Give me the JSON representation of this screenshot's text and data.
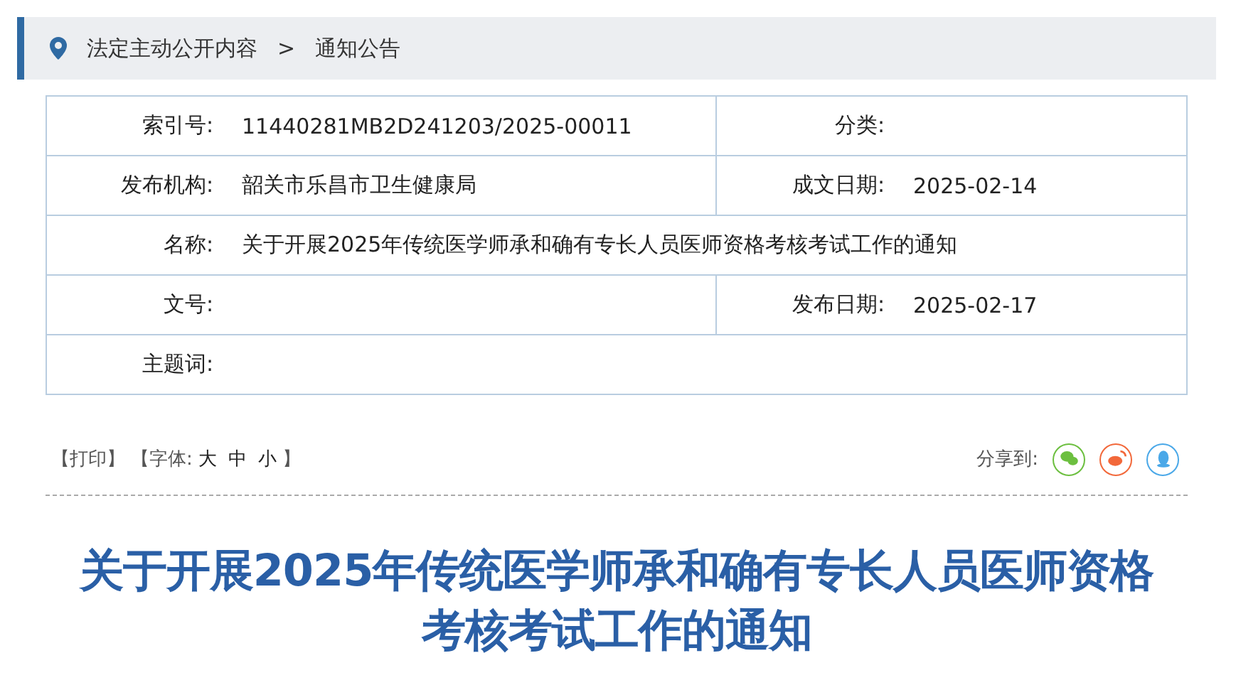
{
  "breadcrumb": {
    "items": [
      {
        "label": "法定主动公开内容"
      },
      {
        "label": "通知公告"
      }
    ],
    "separator": ">"
  },
  "info_table": {
    "rows": [
      {
        "kind": "split",
        "cells": [
          {
            "label": "索引号:",
            "value": "11440281MB2D241203/2025-00011"
          },
          {
            "label": "分类:"
          }
        ]
      },
      {
        "kind": "split",
        "cells": [
          {
            "label": "发布机构:",
            "value": "韶关市乐昌市卫生健康局"
          },
          {
            "label": "成文日期:",
            "value": "2025-02-14"
          }
        ]
      },
      {
        "kind": "full",
        "cells": [
          {
            "label": "名称:",
            "value": "关于开展2025年传统医学师承和确有专长人员医师资格考核考试工作的通知"
          }
        ]
      },
      {
        "kind": "split",
        "cells": [
          {
            "label": "文号:"
          },
          {
            "label": "发布日期:",
            "value": "2025-02-17"
          }
        ]
      },
      {
        "kind": "full",
        "cells": [
          {
            "label": "主题词:"
          }
        ]
      }
    ]
  },
  "toolbar": {
    "print": "【打印】",
    "font_label": "【字体:",
    "font_sizes": [
      "大",
      "中",
      "小"
    ],
    "font_close": "】",
    "share_label": "分享到:",
    "share": [
      {
        "kind": "wechat",
        "color": "#6cbf3f"
      },
      {
        "kind": "weibo",
        "color": "#f2683a"
      },
      {
        "kind": "qq",
        "color": "#4aa8e8"
      }
    ]
  },
  "article": {
    "title_lines": [
      "关于开展2025年传统医学师承和确有专长人员医师资格",
      "考核考试工作的通知"
    ]
  }
}
